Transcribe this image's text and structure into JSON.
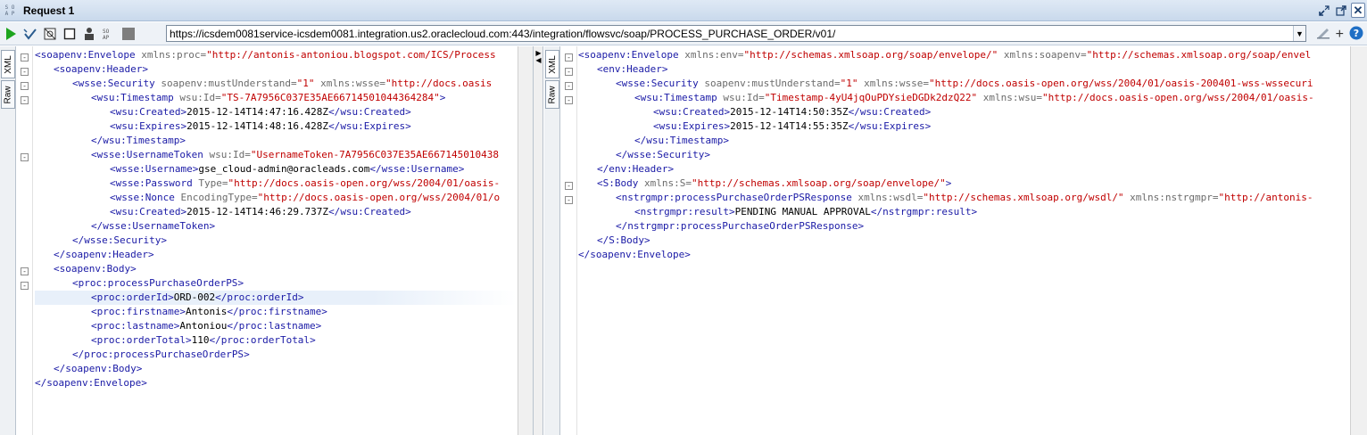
{
  "window": {
    "badge_top": "S O",
    "badge_bottom": "A P",
    "title": "Request 1"
  },
  "toolbar": {
    "url": "https://icsdem0081service-icsdem0081.integration.us2.oraclecloud.com:443/integration/flowsvc/soap/PROCESS_PURCHASE_ORDER/v01/"
  },
  "left_pane": {
    "tabs": [
      "XML",
      "Raw"
    ],
    "lines": [
      {
        "i": 0,
        "parts": [
          [
            "p",
            "<"
          ],
          [
            "t",
            "soapenv:Envelope"
          ],
          [
            "an",
            " xmlns:proc="
          ],
          [
            "av",
            "\"http://antonis-antoniou.blogspot.com/ICS/Process"
          ]
        ],
        "fold": "-"
      },
      {
        "i": 1,
        "parts": [
          [
            "p",
            "<"
          ],
          [
            "t",
            "soapenv:Header"
          ],
          [
            "p",
            ">"
          ]
        ],
        "fold": "-"
      },
      {
        "i": 2,
        "parts": [
          [
            "p",
            "<"
          ],
          [
            "t",
            "wsse:Security"
          ],
          [
            "an",
            " soapenv:mustUnderstand="
          ],
          [
            "av",
            "\"1\""
          ],
          [
            "an",
            " xmlns:wsse="
          ],
          [
            "av",
            "\"http://docs.oasis"
          ]
        ],
        "fold": "-"
      },
      {
        "i": 3,
        "parts": [
          [
            "p",
            "<"
          ],
          [
            "t",
            "wsu:Timestamp"
          ],
          [
            "an",
            " wsu:Id="
          ],
          [
            "av",
            "\"TS-7A7956C037E35AE66714501044364284\""
          ],
          [
            "p",
            ">"
          ]
        ],
        "fold": "-"
      },
      {
        "i": 4,
        "parts": [
          [
            "p",
            "<"
          ],
          [
            "t",
            "wsu:Created"
          ],
          [
            "p",
            ">"
          ],
          [
            "tx",
            "2015-12-14T14:47:16.428Z"
          ],
          [
            "p",
            "</"
          ],
          [
            "t",
            "wsu:Created"
          ],
          [
            "p",
            ">"
          ]
        ]
      },
      {
        "i": 4,
        "parts": [
          [
            "p",
            "<"
          ],
          [
            "t",
            "wsu:Expires"
          ],
          [
            "p",
            ">"
          ],
          [
            "tx",
            "2015-12-14T14:48:16.428Z"
          ],
          [
            "p",
            "</"
          ],
          [
            "t",
            "wsu:Expires"
          ],
          [
            "p",
            ">"
          ]
        ]
      },
      {
        "i": 3,
        "parts": [
          [
            "p",
            "</"
          ],
          [
            "t",
            "wsu:Timestamp"
          ],
          [
            "p",
            ">"
          ]
        ]
      },
      {
        "i": 3,
        "parts": [
          [
            "p",
            "<"
          ],
          [
            "t",
            "wsse:UsernameToken"
          ],
          [
            "an",
            " wsu:Id="
          ],
          [
            "av",
            "\"UsernameToken-7A7956C037E35AE667145010438"
          ]
        ],
        "fold": "-"
      },
      {
        "i": 4,
        "parts": [
          [
            "p",
            "<"
          ],
          [
            "t",
            "wsse:Username"
          ],
          [
            "p",
            ">"
          ],
          [
            "tx",
            "gse_cloud-admin@oracleads.com"
          ],
          [
            "p",
            "</"
          ],
          [
            "t",
            "wsse:Username"
          ],
          [
            "p",
            ">"
          ]
        ]
      },
      {
        "i": 4,
        "parts": [
          [
            "p",
            "<"
          ],
          [
            "t",
            "wsse:Password"
          ],
          [
            "an",
            " Type="
          ],
          [
            "av",
            "\"http://docs.oasis-open.org/wss/2004/01/oasis-"
          ]
        ]
      },
      {
        "i": 4,
        "parts": [
          [
            "p",
            "<"
          ],
          [
            "t",
            "wsse:Nonce"
          ],
          [
            "an",
            " EncodingType="
          ],
          [
            "av",
            "\"http://docs.oasis-open.org/wss/2004/01/o"
          ]
        ]
      },
      {
        "i": 4,
        "parts": [
          [
            "p",
            "<"
          ],
          [
            "t",
            "wsu:Created"
          ],
          [
            "p",
            ">"
          ],
          [
            "tx",
            "2015-12-14T14:46:29.737Z"
          ],
          [
            "p",
            "</"
          ],
          [
            "t",
            "wsu:Created"
          ],
          [
            "p",
            ">"
          ]
        ]
      },
      {
        "i": 3,
        "parts": [
          [
            "p",
            "</"
          ],
          [
            "t",
            "wsse:UsernameToken"
          ],
          [
            "p",
            ">"
          ]
        ]
      },
      {
        "i": 2,
        "parts": [
          [
            "p",
            "</"
          ],
          [
            "t",
            "wsse:Security"
          ],
          [
            "p",
            ">"
          ]
        ]
      },
      {
        "i": 1,
        "parts": [
          [
            "p",
            "</"
          ],
          [
            "t",
            "soapenv:Header"
          ],
          [
            "p",
            ">"
          ]
        ]
      },
      {
        "i": 1,
        "parts": [
          [
            "p",
            "<"
          ],
          [
            "t",
            "soapenv:Body"
          ],
          [
            "p",
            ">"
          ]
        ],
        "fold": "-"
      },
      {
        "i": 2,
        "parts": [
          [
            "p",
            "<"
          ],
          [
            "t",
            "proc:processPurchaseOrderPS"
          ],
          [
            "p",
            ">"
          ]
        ],
        "fold": "-"
      },
      {
        "i": 3,
        "parts": [
          [
            "p",
            "<"
          ],
          [
            "t",
            "proc:orderId"
          ],
          [
            "p",
            ">"
          ],
          [
            "tx",
            "ORD-002"
          ],
          [
            "p",
            "</"
          ],
          [
            "t",
            "proc:orderId"
          ],
          [
            "p",
            ">"
          ]
        ],
        "hl": true
      },
      {
        "i": 3,
        "parts": [
          [
            "p",
            "<"
          ],
          [
            "t",
            "proc:firstname"
          ],
          [
            "p",
            ">"
          ],
          [
            "tx",
            "Antonis"
          ],
          [
            "p",
            "</"
          ],
          [
            "t",
            "proc:firstname"
          ],
          [
            "p",
            ">"
          ]
        ]
      },
      {
        "i": 3,
        "parts": [
          [
            "p",
            "<"
          ],
          [
            "t",
            "proc:lastname"
          ],
          [
            "p",
            ">"
          ],
          [
            "tx",
            "Antoniou"
          ],
          [
            "p",
            "</"
          ],
          [
            "t",
            "proc:lastname"
          ],
          [
            "p",
            ">"
          ]
        ]
      },
      {
        "i": 3,
        "parts": [
          [
            "p",
            "<"
          ],
          [
            "t",
            "proc:orderTotal"
          ],
          [
            "p",
            ">"
          ],
          [
            "tx",
            "110"
          ],
          [
            "p",
            "</"
          ],
          [
            "t",
            "proc:orderTotal"
          ],
          [
            "p",
            ">"
          ]
        ]
      },
      {
        "i": 2,
        "parts": [
          [
            "p",
            "</"
          ],
          [
            "t",
            "proc:processPurchaseOrderPS"
          ],
          [
            "p",
            ">"
          ]
        ]
      },
      {
        "i": 1,
        "parts": [
          [
            "p",
            "</"
          ],
          [
            "t",
            "soapenv:Body"
          ],
          [
            "p",
            ">"
          ]
        ]
      },
      {
        "i": 0,
        "parts": [
          [
            "p",
            "</"
          ],
          [
            "t",
            "soapenv:Envelope"
          ],
          [
            "p",
            ">"
          ]
        ]
      }
    ]
  },
  "right_pane": {
    "tabs": [
      "XML",
      "Raw"
    ],
    "lines": [
      {
        "i": 0,
        "parts": [
          [
            "p",
            "<"
          ],
          [
            "t",
            "soapenv:Envelope"
          ],
          [
            "an",
            " xmlns:env="
          ],
          [
            "av",
            "\"http://schemas.xmlsoap.org/soap/envelope/\""
          ],
          [
            "an",
            " xmlns:soapenv="
          ],
          [
            "av",
            "\"http://schemas.xmlsoap.org/soap/envel"
          ]
        ],
        "fold": "-"
      },
      {
        "i": 1,
        "parts": [
          [
            "p",
            "<"
          ],
          [
            "t",
            "env:Header"
          ],
          [
            "p",
            ">"
          ]
        ],
        "fold": "-"
      },
      {
        "i": 2,
        "parts": [
          [
            "p",
            "<"
          ],
          [
            "t",
            "wsse:Security"
          ],
          [
            "an",
            " soapenv:mustUnderstand="
          ],
          [
            "av",
            "\"1\""
          ],
          [
            "an",
            " xmlns:wsse="
          ],
          [
            "av",
            "\"http://docs.oasis-open.org/wss/2004/01/oasis-200401-wss-wssecuri"
          ]
        ],
        "fold": "-"
      },
      {
        "i": 3,
        "parts": [
          [
            "p",
            "<"
          ],
          [
            "t",
            "wsu:Timestamp"
          ],
          [
            "an",
            " wsu:Id="
          ],
          [
            "av",
            "\"Timestamp-4yU4jqOuPDYsieDGDk2dzQ22\""
          ],
          [
            "an",
            " xmlns:wsu="
          ],
          [
            "av",
            "\"http://docs.oasis-open.org/wss/2004/01/oasis-"
          ]
        ],
        "fold": "-"
      },
      {
        "i": 4,
        "parts": [
          [
            "p",
            "<"
          ],
          [
            "t",
            "wsu:Created"
          ],
          [
            "p",
            ">"
          ],
          [
            "tx",
            "2015-12-14T14:50:35Z"
          ],
          [
            "p",
            "</"
          ],
          [
            "t",
            "wsu:Created"
          ],
          [
            "p",
            ">"
          ]
        ]
      },
      {
        "i": 4,
        "parts": [
          [
            "p",
            "<"
          ],
          [
            "t",
            "wsu:Expires"
          ],
          [
            "p",
            ">"
          ],
          [
            "tx",
            "2015-12-14T14:55:35Z"
          ],
          [
            "p",
            "</"
          ],
          [
            "t",
            "wsu:Expires"
          ],
          [
            "p",
            ">"
          ]
        ]
      },
      {
        "i": 3,
        "parts": [
          [
            "p",
            "</"
          ],
          [
            "t",
            "wsu:Timestamp"
          ],
          [
            "p",
            ">"
          ]
        ]
      },
      {
        "i": 2,
        "parts": [
          [
            "p",
            "</"
          ],
          [
            "t",
            "wsse:Security"
          ],
          [
            "p",
            ">"
          ]
        ]
      },
      {
        "i": 1,
        "parts": [
          [
            "p",
            "</"
          ],
          [
            "t",
            "env:Header"
          ],
          [
            "p",
            ">"
          ]
        ]
      },
      {
        "i": 1,
        "parts": [
          [
            "p",
            "<"
          ],
          [
            "t",
            "S:Body"
          ],
          [
            "an",
            " xmlns:S="
          ],
          [
            "av",
            "\"http://schemas.xmlsoap.org/soap/envelope/\""
          ],
          [
            "p",
            ">"
          ]
        ],
        "fold": "-"
      },
      {
        "i": 2,
        "parts": [
          [
            "p",
            "<"
          ],
          [
            "t",
            "nstrgmpr:processPurchaseOrderPSResponse"
          ],
          [
            "an",
            " xmlns:wsdl="
          ],
          [
            "av",
            "\"http://schemas.xmlsoap.org/wsdl/\""
          ],
          [
            "an",
            " xmlns:nstrgmpr="
          ],
          [
            "av",
            "\"http://antonis-"
          ]
        ],
        "fold": "-"
      },
      {
        "i": 3,
        "parts": [
          [
            "p",
            "<"
          ],
          [
            "t",
            "nstrgmpr:result"
          ],
          [
            "p",
            ">"
          ],
          [
            "tx",
            "PENDING MANUAL APPROVAL"
          ],
          [
            "p",
            "</"
          ],
          [
            "t",
            "nstrgmpr:result"
          ],
          [
            "p",
            ">"
          ]
        ]
      },
      {
        "i": 2,
        "parts": [
          [
            "p",
            "</"
          ],
          [
            "t",
            "nstrgmpr:processPurchaseOrderPSResponse"
          ],
          [
            "p",
            ">"
          ]
        ]
      },
      {
        "i": 1,
        "parts": [
          [
            "p",
            "</"
          ],
          [
            "t",
            "S:Body"
          ],
          [
            "p",
            ">"
          ]
        ]
      },
      {
        "i": 0,
        "parts": [
          [
            "p",
            "</"
          ],
          [
            "t",
            "soapenv:Envelope"
          ],
          [
            "p",
            ">"
          ]
        ]
      }
    ]
  }
}
